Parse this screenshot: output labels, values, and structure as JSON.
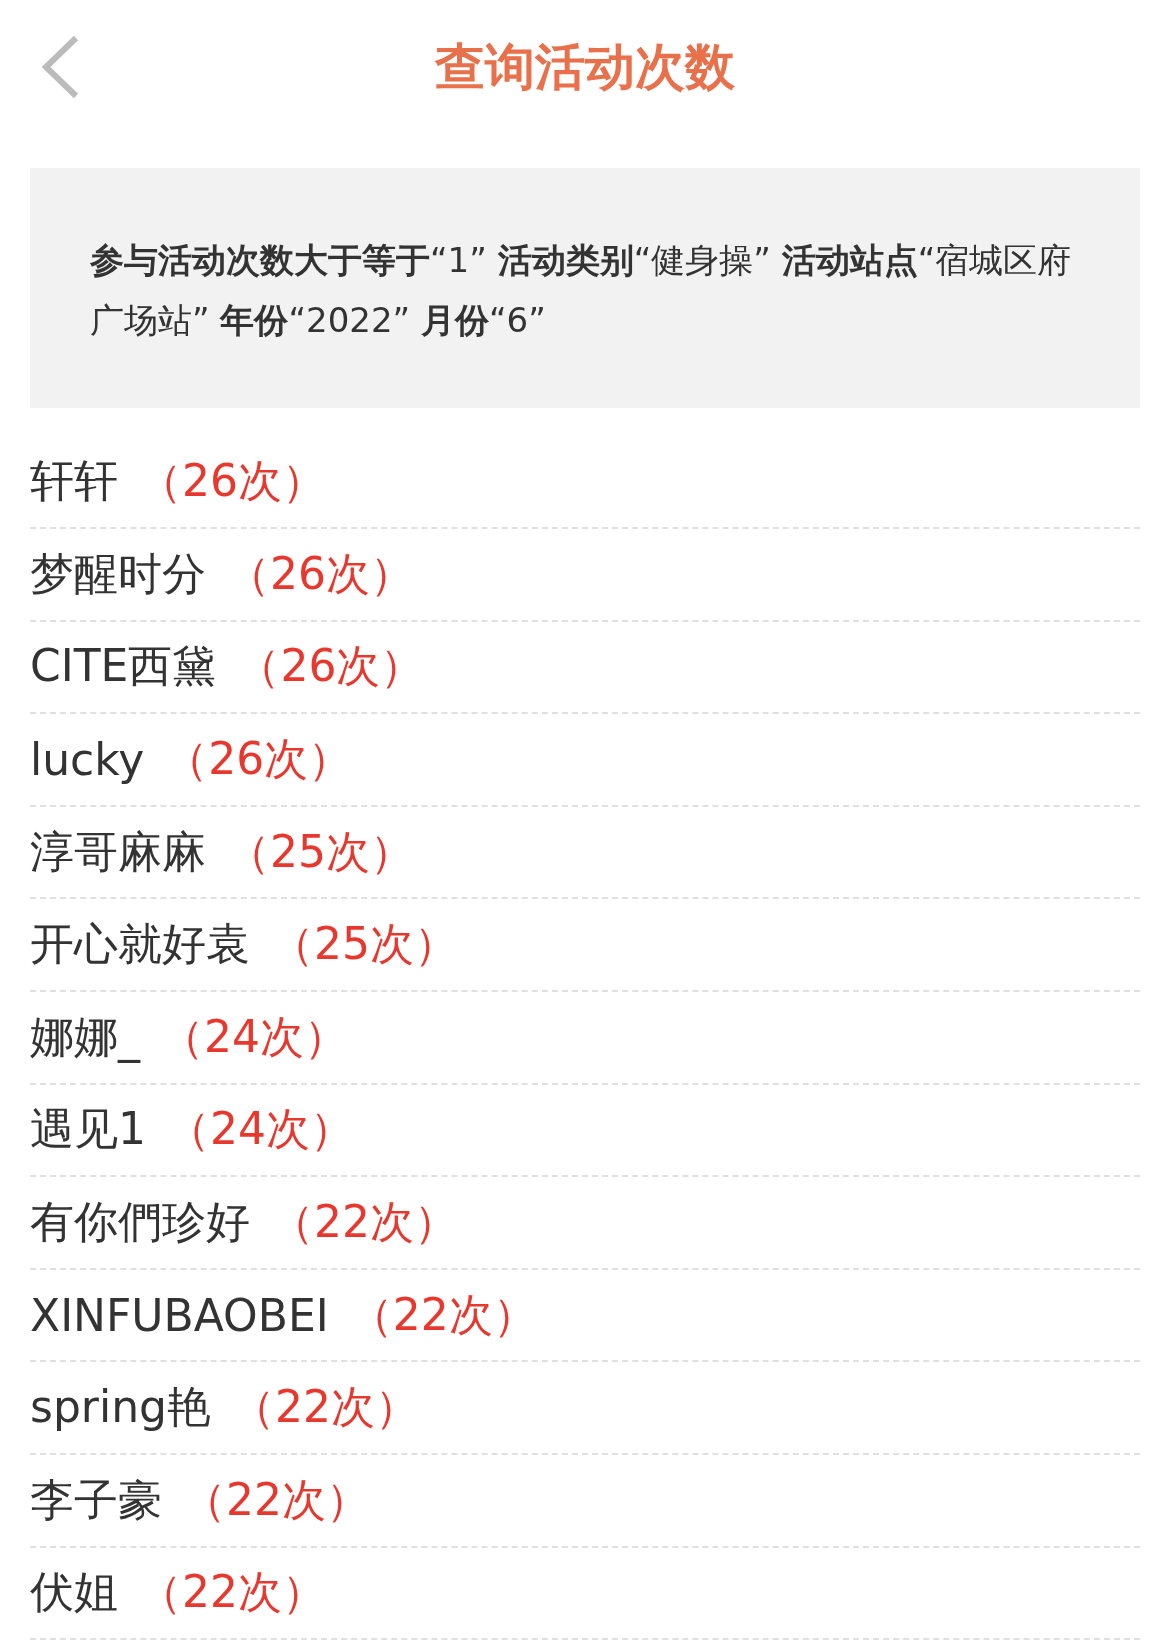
{
  "header": {
    "title": "查询活动次数"
  },
  "filter": {
    "text": "**参与活动次数大于等于**“1” **活动类别**“健身操” **活动站点**“宿城区府广场站” **年份**“2022” **月份**“6”"
  },
  "rows": [
    {
      "name": "轩轩",
      "count": "（26次）"
    },
    {
      "name": "梦醒时分",
      "count": "（26次）"
    },
    {
      "name": "CITE西黛",
      "count": "（26次）"
    },
    {
      "name": "lucky",
      "count": "（26次）"
    },
    {
      "name": "淳哥麻麻",
      "count": "（25次）"
    },
    {
      "name": "开心就好袁",
      "count": "（25次）"
    },
    {
      "name": "娜娜_",
      "count": "（24次）"
    },
    {
      "name": "遇见1",
      "count": "（24次）"
    },
    {
      "name": "有你們珍好",
      "count": "（22次）"
    },
    {
      "name": "XINFUBAOBEI",
      "count": "（22次）"
    },
    {
      "name": "spring艳",
      "count": "（22次）"
    },
    {
      "name": "李子豪",
      "count": "（22次）"
    },
    {
      "name": "伏姐",
      "count": "（22次）"
    }
  ]
}
